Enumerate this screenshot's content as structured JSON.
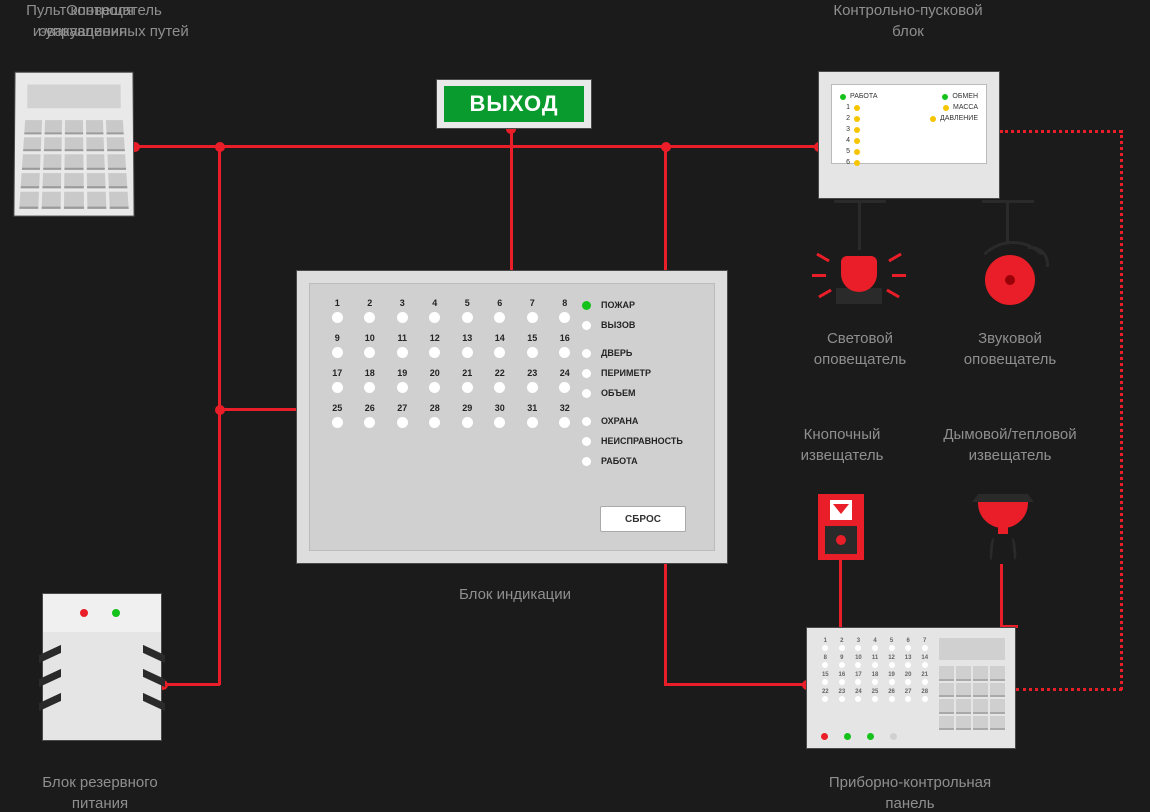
{
  "labels": {
    "keypad": "Пульт контроля\nи управления",
    "exit": "Оповещатель\nэвакуационных путей",
    "ctrl": "Контрольно-пусковой\nблок",
    "light": "Световой\nоповещатель",
    "sound": "Звуковой\nоповещатель",
    "callpoint": "Кнопочный\nизвещатель",
    "detector": "Дымовой/тепловой\nизвещатель",
    "indicator": "Блок индикации",
    "backup": "Блок резервного\nпитания",
    "panel": "Приборно-контрольная\nпанель"
  },
  "exit_text": "ВЫХОД",
  "ctrl_block": {
    "work": "РАБОТА",
    "exchange": "ОБМЕН",
    "mass": "МАССА",
    "pressure": "ДАВЛЕНИЕ",
    "rows": [
      "1",
      "2",
      "3",
      "4",
      "5",
      "6"
    ]
  },
  "indicator": {
    "cells": [
      "1",
      "2",
      "3",
      "4",
      "5",
      "6",
      "7",
      "8",
      "9",
      "10",
      "11",
      "12",
      "13",
      "14",
      "15",
      "16",
      "17",
      "18",
      "19",
      "20",
      "21",
      "22",
      "23",
      "24",
      "25",
      "26",
      "27",
      "28",
      "29",
      "30",
      "31",
      "32"
    ],
    "legend": [
      "ПОЖАР",
      "ВЫЗОВ",
      "ДВЕРЬ",
      "ПЕРИМЕТР",
      "ОБЪЕМ",
      "ОХРАНА",
      "НЕИСПРАВНОСТЬ",
      "РАБОТА"
    ],
    "legend_active": 0,
    "reset": "СБРОС"
  },
  "panel": {
    "cells": [
      "1",
      "2",
      "3",
      "4",
      "5",
      "6",
      "7",
      "8",
      "9",
      "10",
      "11",
      "12",
      "13",
      "14",
      "15",
      "16",
      "17",
      "18",
      "19",
      "20",
      "21",
      "22",
      "23",
      "24",
      "25",
      "26",
      "27",
      "28"
    ]
  }
}
